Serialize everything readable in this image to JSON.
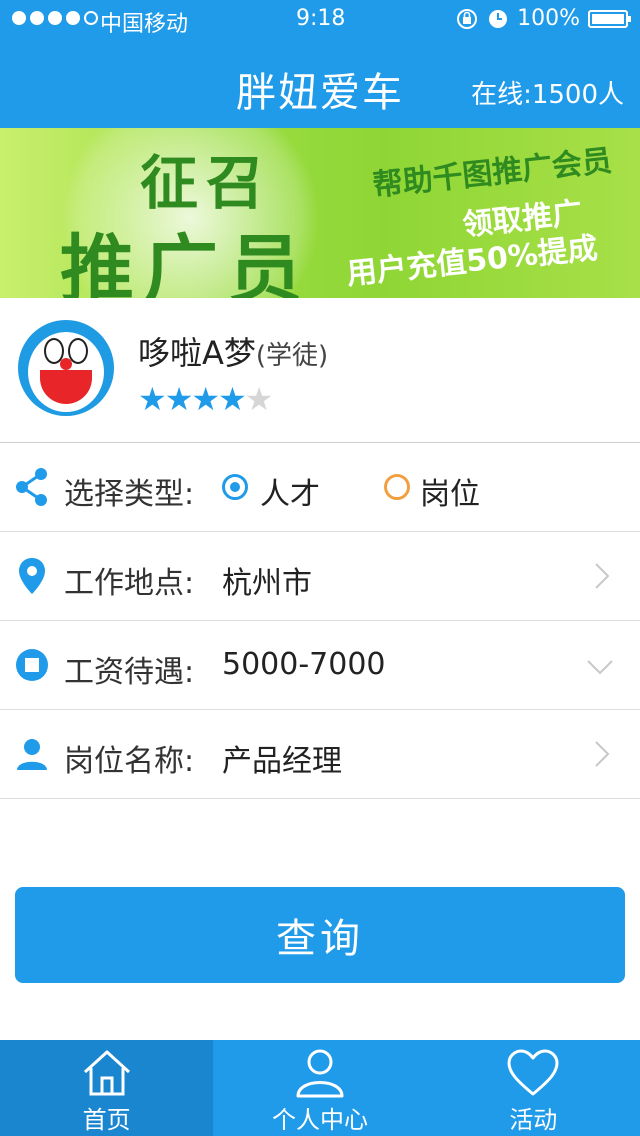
{
  "status_bar": {
    "carrier": "中国移动",
    "time": "9:18",
    "battery": "100%",
    "signal_strength": 4,
    "signal_max": 5
  },
  "nav": {
    "title": "胖妞爱车",
    "online": "在线:1500人"
  },
  "banner": {
    "title_top": "征召",
    "title_bottom": "推广员",
    "line1": "帮助千图推广会员",
    "line2": "领取推广",
    "line3": "用户充值50%提成"
  },
  "profile": {
    "name": "哆啦A梦",
    "role": "(学徒)",
    "rating": 4,
    "rating_max": 5
  },
  "form": {
    "type": {
      "label": "选择类型:",
      "options": [
        "人才",
        "岗位"
      ],
      "selected": "人才"
    },
    "location": {
      "label": "工作地点:",
      "value": "杭州市"
    },
    "salary": {
      "label": "工资待遇:",
      "value": "5000-7000"
    },
    "position": {
      "label": "岗位名称:",
      "value": "产品经理"
    }
  },
  "query_button": "查询",
  "tabs": [
    {
      "label": "首页",
      "icon": "home-icon",
      "active": true
    },
    {
      "label": "个人中心",
      "icon": "user-icon",
      "active": false
    },
    {
      "label": "活动",
      "icon": "heart-icon",
      "active": false
    }
  ],
  "colors": {
    "primary": "#1f9bea",
    "tab_active": "#1a86d0",
    "radio_unchecked": "#f0a040",
    "star_off": "#d6d6d6"
  }
}
